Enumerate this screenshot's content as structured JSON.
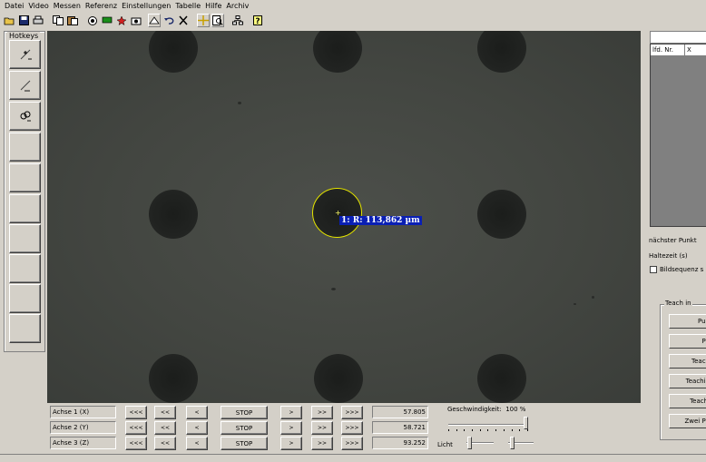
{
  "menu": {
    "items": [
      "Datei",
      "Video",
      "Messen",
      "Referenz",
      "Einstellungen",
      "Tabelle",
      "Hilfe",
      "Archiv"
    ]
  },
  "toolbar": {
    "icons": [
      "open-icon",
      "save-icon",
      "print-icon",
      "copy-icon",
      "paste-icon",
      "camera-icon",
      "green-flag-icon",
      "red-star-icon",
      "capture-icon",
      "select-icon",
      "undo-icon",
      "close-icon",
      "crosshair-icon",
      "zoom-icon",
      "network-icon",
      "help-icon"
    ]
  },
  "hotkeys": {
    "label": "Hotkeys"
  },
  "camera": {
    "measurement": "1: R: 113,862 µm",
    "ring_color": "#e6e600",
    "label_bg": "#0a1fb4"
  },
  "table": {
    "col_nr": "lfd. Nr.",
    "col_x": "X"
  },
  "side": {
    "next_point": "nächster Punkt",
    "hold_time": "Haltezeit (s)",
    "image_sequence": "Bildsequenz s",
    "image_sequence_checked": false
  },
  "teach": {
    "label": "Teach in",
    "buttons": [
      "Pun",
      "Pu",
      "Teach",
      "Teachin",
      "Teachl",
      "Zwei Pu"
    ]
  },
  "axes": [
    {
      "label": "Achse 1 (X)",
      "value": "57.805"
    },
    {
      "label": "Achse 2 (Y)",
      "value": "58.721"
    },
    {
      "label": "Achse 3 (Z)",
      "value": "93.252"
    }
  ],
  "controls": {
    "fast_back": "<<<",
    "back": "<<",
    "step_back": "<",
    "stop": "STOP",
    "step_fwd": ">",
    "fwd": ">>",
    "fast_fwd": ">>>"
  },
  "speed": {
    "label": "Geschwindigkeit:",
    "value": "100 %",
    "level": 1.0
  },
  "light": {
    "label": "Licht",
    "level_1": 0.05,
    "level_2": 0.1
  }
}
